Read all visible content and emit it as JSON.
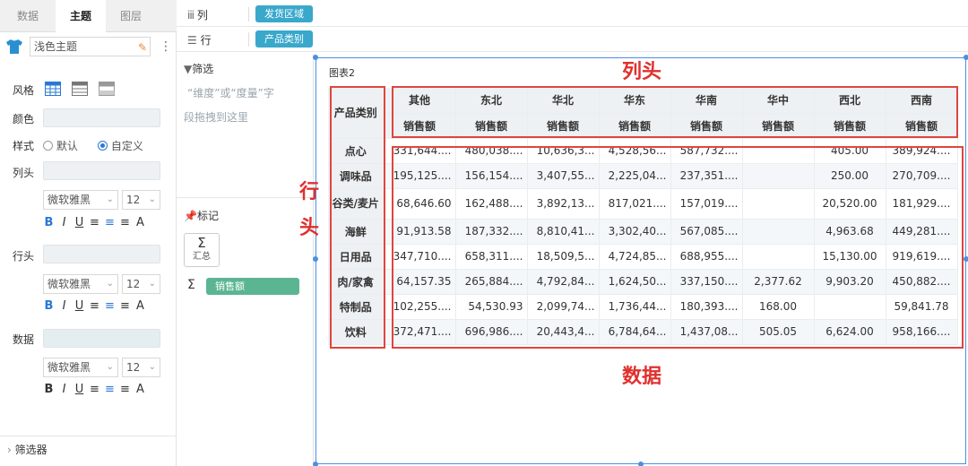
{
  "left_panel": {
    "tabs": [
      "数据",
      "主题",
      "图层"
    ],
    "active_tab": "主题",
    "theme_value": "浅色主题",
    "labels": {
      "style": "风格",
      "color": "颜色",
      "mode": "样式",
      "col_header": "列头",
      "row_header": "行头",
      "data": "数据"
    },
    "mode_options": [
      "默认",
      "自定义"
    ],
    "mode_selected": "自定义",
    "font_family": "微软雅黑",
    "font_size": "12",
    "format_buttons": [
      "B",
      "I",
      "U",
      "≡",
      "≡",
      "≡",
      "A"
    ],
    "filter_footer": "筛选器"
  },
  "mid_panel": {
    "filter_title": "筛选",
    "filter_hint_1": "“维度”或“度量”字",
    "filter_hint_2": "段拖拽到这里",
    "marks_title": "标记",
    "sum_label": "汇总",
    "measure_pill": "销售额"
  },
  "shelves": {
    "columns_label": "列",
    "columns_pill": "发货区域",
    "rows_label": "行",
    "rows_pill": "产品类别"
  },
  "chart": {
    "title": "图表2",
    "row_header_title": "产品类别",
    "columns": [
      "其他",
      "东北",
      "华北",
      "华东",
      "华南",
      "华中",
      "西北",
      "西南"
    ],
    "measure": "销售额",
    "rows": [
      {
        "name": "点心",
        "values": [
          "331,644....",
          "480,038....",
          "10,636,3...",
          "4,528,56...",
          "587,732....",
          "",
          "405.00",
          "389,924...."
        ]
      },
      {
        "name": "调味品",
        "values": [
          "195,125....",
          "156,154....",
          "3,407,55...",
          "2,225,04...",
          "237,351....",
          "",
          "250.00",
          "270,709...."
        ]
      },
      {
        "name": "谷类/麦片",
        "values": [
          "68,646.60",
          "162,488....",
          "3,892,13...",
          "817,021....",
          "157,019....",
          "",
          "20,520.00",
          "181,929...."
        ]
      },
      {
        "name": "海鲜",
        "values": [
          "91,913.58",
          "187,332....",
          "8,810,41...",
          "3,302,40...",
          "567,085....",
          "",
          "4,963.68",
          "449,281...."
        ]
      },
      {
        "name": "日用品",
        "values": [
          "347,710....",
          "658,311....",
          "18,509,5...",
          "4,724,85...",
          "688,955....",
          "",
          "15,130.00",
          "919,619...."
        ]
      },
      {
        "name": "肉/家禽",
        "values": [
          "64,157.35",
          "265,884....",
          "4,792,84...",
          "1,624,50...",
          "337,150....",
          "2,377.62",
          "9,903.20",
          "450,882...."
        ]
      },
      {
        "name": "特制品",
        "values": [
          "102,255....",
          "54,530.93",
          "2,099,74...",
          "1,736,44...",
          "180,393....",
          "168.00",
          "",
          "59,841.78"
        ]
      },
      {
        "name": "饮料",
        "values": [
          "372,471....",
          "696,986....",
          "20,443,4...",
          "6,784,64...",
          "1,437,08...",
          "505.05",
          "6,624.00",
          "958,166...."
        ]
      }
    ]
  },
  "annotations": {
    "col_header": "列头",
    "row_header": "行头",
    "data": "数据"
  },
  "colors": {
    "accent": "#39a8cb",
    "measure": "#5bb592",
    "annotation": "#e0302c",
    "selection": "#4a90e2"
  }
}
